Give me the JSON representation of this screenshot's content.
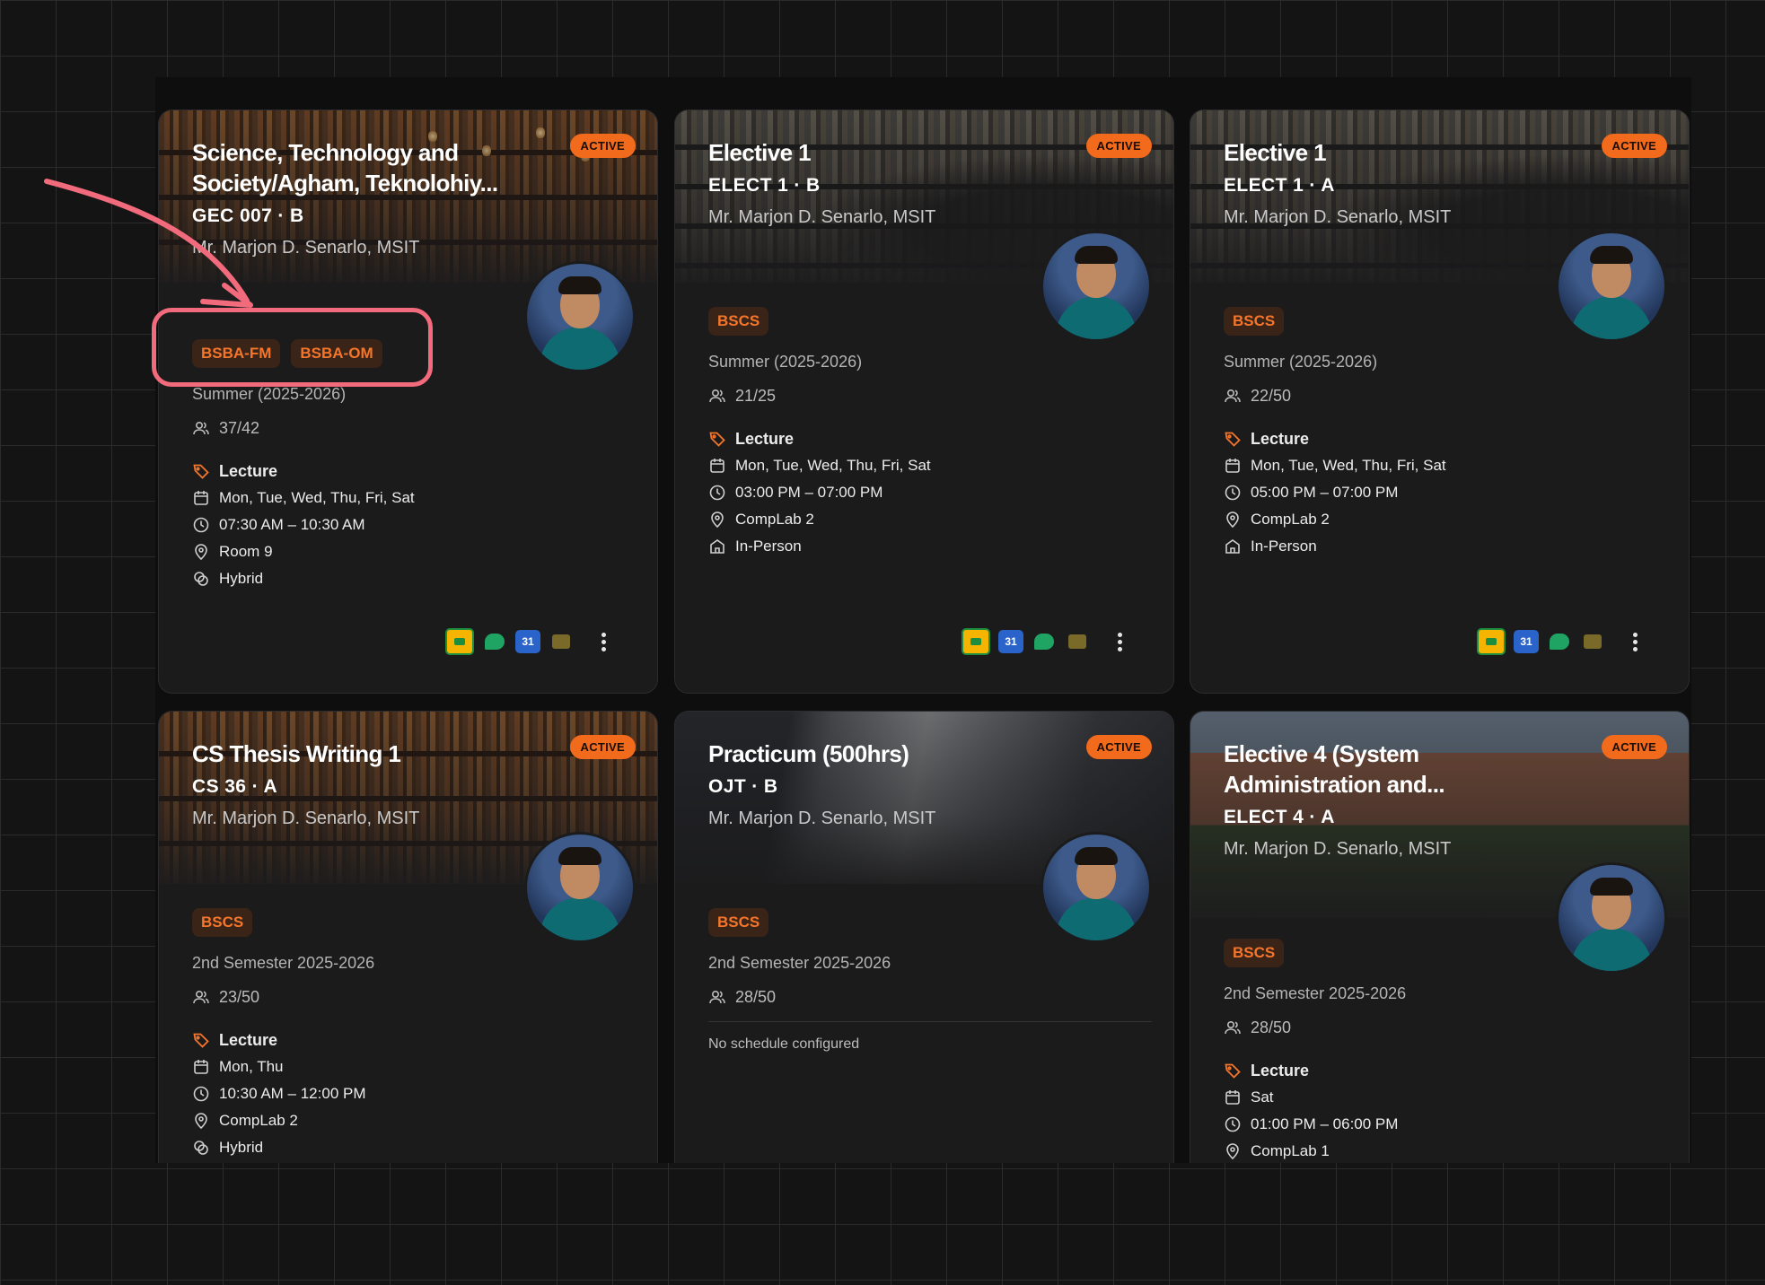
{
  "cards": [
    {
      "status": "ACTIVE",
      "title": "Science, Technology and Society/Agham, Teknolohiy...",
      "code": "GEC 007 · B",
      "instructor": "Mr. Marjon D. Senarlo, MSIT",
      "tags": [
        "BSBA-FM",
        "BSBA-OM"
      ],
      "term": "Summer (2025-2026)",
      "students": "37/42",
      "type": "Lecture",
      "days": "Mon, Tue, Wed, Thu, Fri, Sat",
      "time": "07:30 AM – 10:30 AM",
      "room": "Room 9",
      "mode": "Hybrid",
      "apps": [
        "classroom-icon",
        "chat-icon",
        "calendar-icon",
        "meet-icon"
      ],
      "calendar_label": "31"
    },
    {
      "status": "ACTIVE",
      "title": "Elective 1",
      "code": "ELECT 1 · B",
      "instructor": "Mr. Marjon D. Senarlo, MSIT",
      "tags": [
        "BSCS"
      ],
      "term": "Summer (2025-2026)",
      "students": "21/25",
      "type": "Lecture",
      "days": "Mon, Tue, Wed, Thu, Fri, Sat",
      "time": "03:00 PM – 07:00 PM",
      "room": "CompLab 2",
      "mode": "In-Person",
      "apps": [
        "classroom-icon",
        "calendar-icon",
        "chat-icon",
        "meet-icon"
      ],
      "calendar_label": "31"
    },
    {
      "status": "ACTIVE",
      "title": "Elective 1",
      "code": "ELECT 1 · A",
      "instructor": "Mr. Marjon D. Senarlo, MSIT",
      "tags": [
        "BSCS"
      ],
      "term": "Summer (2025-2026)",
      "students": "22/50",
      "type": "Lecture",
      "days": "Mon, Tue, Wed, Thu, Fri, Sat",
      "time": "05:00 PM – 07:00 PM",
      "room": "CompLab 2",
      "mode": "In-Person",
      "apps": [
        "classroom-icon",
        "calendar-icon",
        "chat-icon",
        "meet-icon"
      ],
      "calendar_label": "31"
    },
    {
      "status": "ACTIVE",
      "title": "CS Thesis Writing 1",
      "code": "CS 36 · A",
      "instructor": "Mr. Marjon D. Senarlo, MSIT",
      "tags": [
        "BSCS"
      ],
      "term": "2nd Semester 2025-2026",
      "students": "23/50",
      "type": "Lecture",
      "days": "Mon, Thu",
      "time": "10:30 AM – 12:00 PM",
      "room": "CompLab 2",
      "mode": "Hybrid"
    },
    {
      "status": "ACTIVE",
      "title": "Practicum (500hrs)",
      "code": "OJT · B",
      "instructor": "Mr. Marjon D. Senarlo, MSIT",
      "tags": [
        "BSCS"
      ],
      "term": "2nd Semester 2025-2026",
      "students": "28/50",
      "no_schedule": "No schedule configured"
    },
    {
      "status": "ACTIVE",
      "title": "Elective 4 (System Administration and...",
      "code": "ELECT 4 · A",
      "instructor": "Mr. Marjon D. Senarlo, MSIT",
      "tags": [
        "BSCS"
      ],
      "term": "2nd Semester 2025-2026",
      "students": "28/50",
      "type": "Lecture",
      "days": "Sat",
      "time": "01:00 PM – 06:00 PM",
      "room": "CompLab 1"
    }
  ],
  "colors": {
    "accent": "#f26a1b",
    "tag_text": "#f5762a",
    "annotation": "#f26b7c",
    "card_bg": "#1b1b1c"
  }
}
